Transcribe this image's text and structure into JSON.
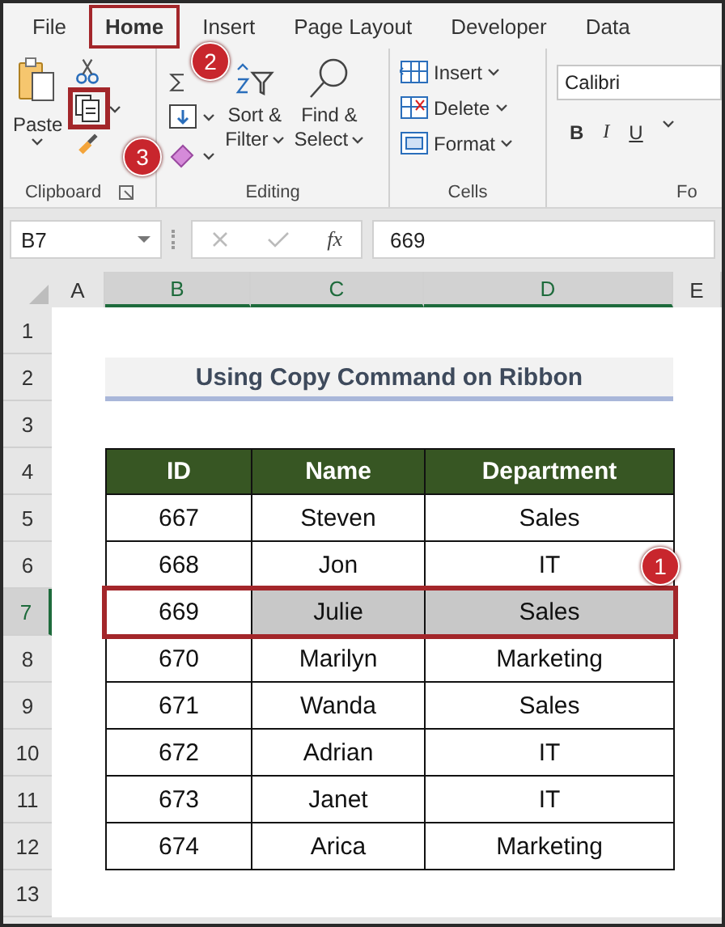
{
  "menu_tabs": [
    {
      "label": "File",
      "selected": false
    },
    {
      "label": "Home",
      "selected": true,
      "badge": "2"
    },
    {
      "label": "Insert",
      "selected": false
    },
    {
      "label": "Page Layout",
      "selected": false
    },
    {
      "label": "Developer",
      "selected": false
    },
    {
      "label": "Data",
      "selected": false
    }
  ],
  "ribbon": {
    "clipboard": {
      "label": "Clipboard",
      "paste": "Paste",
      "copy_highlighted": true,
      "copy_badge": "3"
    },
    "editing": {
      "label": "Editing",
      "sort": [
        "Sort &",
        "Filter"
      ],
      "find": [
        "Find &",
        "Select"
      ]
    },
    "cells": {
      "label": "Cells",
      "commands": [
        "Insert",
        "Delete",
        "Format"
      ]
    },
    "font": {
      "label": "Fo",
      "font_name": "Calibri",
      "styles": [
        "B",
        "I",
        "U"
      ]
    }
  },
  "formula_bar": {
    "name_box": "B7",
    "function_label": "fx",
    "value": "669"
  },
  "columns": [
    {
      "label": "A",
      "selected": false
    },
    {
      "label": "B",
      "selected": true
    },
    {
      "label": "C",
      "selected": true
    },
    {
      "label": "D",
      "selected": true
    },
    {
      "label": "E",
      "selected": false
    }
  ],
  "row_numbers": [
    {
      "label": "1",
      "selected": false
    },
    {
      "label": "2",
      "selected": false
    },
    {
      "label": "3",
      "selected": false
    },
    {
      "label": "4",
      "selected": false
    },
    {
      "label": "5",
      "selected": false
    },
    {
      "label": "6",
      "selected": false
    },
    {
      "label": "7",
      "selected": true
    },
    {
      "label": "8",
      "selected": false
    },
    {
      "label": "9",
      "selected": false
    },
    {
      "label": "10",
      "selected": false
    },
    {
      "label": "11",
      "selected": false
    },
    {
      "label": "12",
      "selected": false
    },
    {
      "label": "13",
      "selected": false
    }
  ],
  "sheet_title": "Using Copy Command on Ribbon",
  "table": {
    "columns": [
      "ID",
      "Name",
      "Department"
    ],
    "rows": [
      {
        "cells": [
          "667",
          "Steven",
          "Sales"
        ],
        "selected": false
      },
      {
        "cells": [
          "668",
          "Jon",
          "IT"
        ],
        "selected": false
      },
      {
        "cells": [
          "669",
          "Julie",
          "Sales"
        ],
        "selected": true,
        "badge": "1"
      },
      {
        "cells": [
          "670",
          "Marilyn",
          "Marketing"
        ],
        "selected": false
      },
      {
        "cells": [
          "671",
          "Wanda",
          "Sales"
        ],
        "selected": false
      },
      {
        "cells": [
          "672",
          "Adrian",
          "IT"
        ],
        "selected": false
      },
      {
        "cells": [
          "673",
          "Janet",
          "IT"
        ],
        "selected": false
      },
      {
        "cells": [
          "674",
          "Arica",
          "Marketing"
        ],
        "selected": false
      }
    ]
  }
}
